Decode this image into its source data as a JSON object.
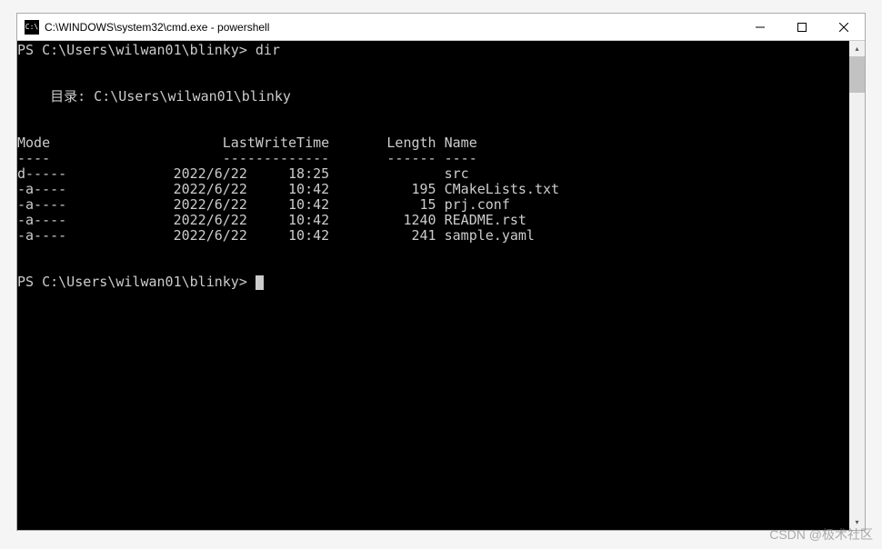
{
  "window": {
    "title": "C:\\WINDOWS\\system32\\cmd.exe - powershell",
    "icon_text": "C:\\"
  },
  "terminal": {
    "prompt_line_1": "PS C:\\Users\\wilwan01\\blinky> ",
    "cmd_1": "dir",
    "dir_header_prefix": "    目录: ",
    "dir_header_path": "C:\\Users\\wilwan01\\blinky",
    "columns": {
      "mode_label": "Mode",
      "lastwrite_label": "LastWriteTime",
      "length_label": "Length",
      "name_label": "Name"
    },
    "rows": [
      {
        "mode": "d-----",
        "date": "2022/6/22",
        "time": "18:25",
        "length": "",
        "name": "src"
      },
      {
        "mode": "-a----",
        "date": "2022/6/22",
        "time": "10:42",
        "length": "195",
        "name": "CMakeLists.txt"
      },
      {
        "mode": "-a----",
        "date": "2022/6/22",
        "time": "10:42",
        "length": "15",
        "name": "prj.conf"
      },
      {
        "mode": "-a----",
        "date": "2022/6/22",
        "time": "10:42",
        "length": "1240",
        "name": "README.rst"
      },
      {
        "mode": "-a----",
        "date": "2022/6/22",
        "time": "10:42",
        "length": "241",
        "name": "sample.yaml"
      }
    ],
    "prompt_line_2": "PS C:\\Users\\wilwan01\\blinky> "
  },
  "watermark": "CSDN @极术社区"
}
